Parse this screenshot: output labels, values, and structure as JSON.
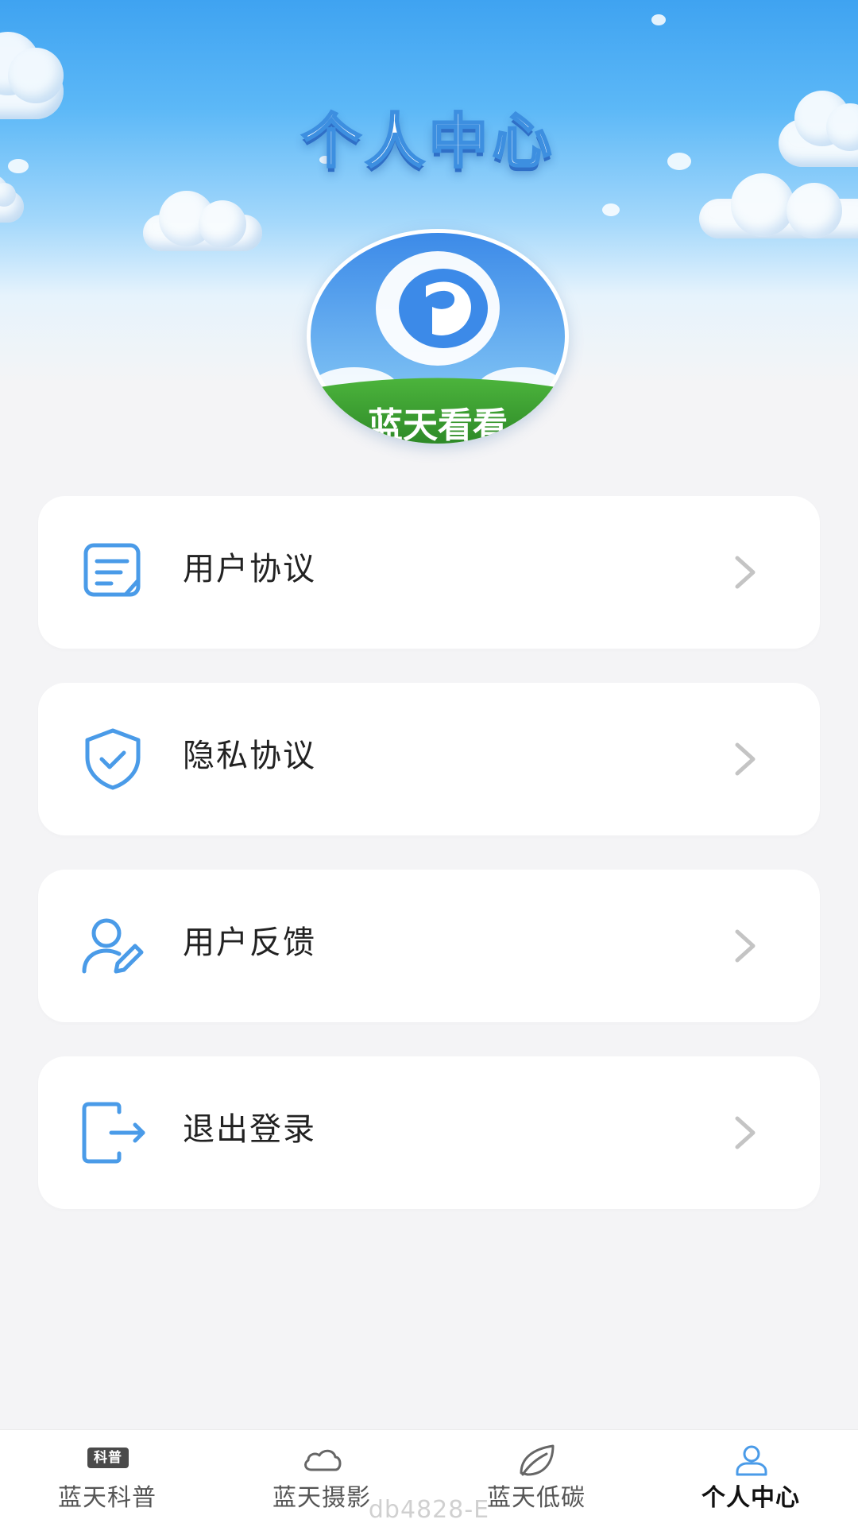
{
  "header": {
    "title": "个人中心"
  },
  "logo": {
    "caption": "蓝天看看"
  },
  "menu": {
    "items": [
      {
        "label": "用户协议",
        "icon": "document-icon"
      },
      {
        "label": "隐私协议",
        "icon": "shield-check-icon"
      },
      {
        "label": "用户反馈",
        "icon": "user-edit-icon"
      },
      {
        "label": "退出登录",
        "icon": "logout-icon"
      }
    ]
  },
  "tabbar": {
    "tabs": [
      {
        "label": "蓝天科普",
        "icon": "science-badge-icon",
        "badge_text": "科普",
        "active": false
      },
      {
        "label": "蓝天摄影",
        "icon": "cloud-icon",
        "active": false
      },
      {
        "label": "蓝天低碳",
        "icon": "leaf-icon",
        "active": false
      },
      {
        "label": "个人中心",
        "icon": "user-icon",
        "active": true
      }
    ]
  },
  "watermark": "db4828-E",
  "colors": {
    "accent": "#4a9be8",
    "sky": "#3fa3f1",
    "chevron": "#c4c4c4"
  }
}
